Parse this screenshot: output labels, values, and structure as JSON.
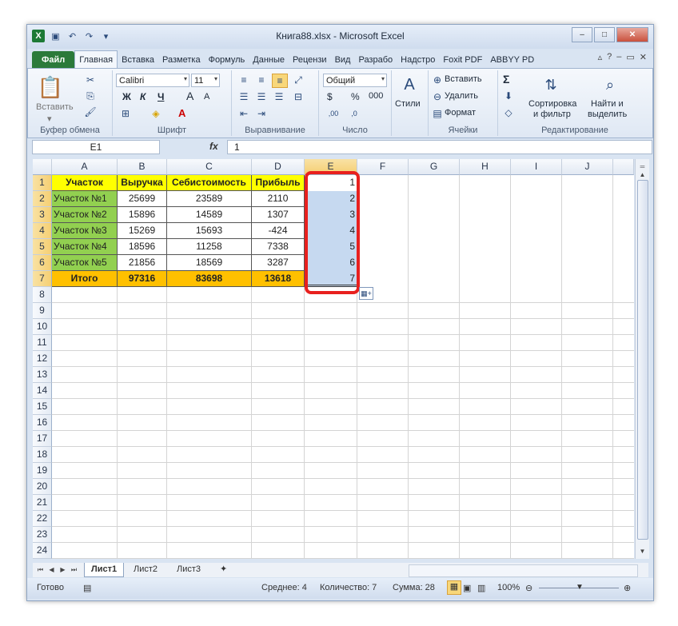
{
  "window": {
    "title": "Книга88.xlsx - Microsoft Excel",
    "min_label": "–",
    "max_label": "□",
    "close_label": "✕"
  },
  "qat": [
    "save-icon",
    "undo-icon",
    "redo-icon",
    "dropdown-icon"
  ],
  "ribbon_tabs": [
    "Файл",
    "Главная",
    "Вставка",
    "Разметка",
    "Формуль",
    "Данные",
    "Рецензи",
    "Вид",
    "Разрабо",
    "Надстро",
    "Foxit PDF",
    "ABBYY PD"
  ],
  "ribbon": {
    "clipboard": {
      "paste_label": "Вставить",
      "group_label": "Буфер обмена"
    },
    "font": {
      "font_name": "Calibri",
      "font_size": "11",
      "bold": "Ж",
      "italic": "К",
      "underline": "Ч",
      "grow": "A",
      "shrink": "A",
      "group_label": "Шрифт"
    },
    "alignment": {
      "group_label": "Выравнивание"
    },
    "number": {
      "format": "Общий",
      "currency": "$",
      "percent": "%",
      "thousands": "000",
      "group_label": "Число"
    },
    "styles": {
      "label": "Стили"
    },
    "cells": {
      "insert": "Вставить",
      "delete": "Удалить",
      "format": "Формат",
      "group_label": "Ячейки"
    },
    "editing": {
      "sum": "Σ",
      "sort_line1": "Сортировка",
      "sort_line2": "и фильтр",
      "find_line1": "Найти и",
      "find_line2": "выделить",
      "group_label": "Редактирование"
    }
  },
  "formula_bar": {
    "name_box": "E1",
    "fx": "fx",
    "value": "1"
  },
  "columns": [
    "A",
    "B",
    "C",
    "D",
    "E",
    "F",
    "G",
    "H",
    "I",
    "J"
  ],
  "rows": [
    "1",
    "2",
    "3",
    "4",
    "5",
    "6",
    "7",
    "8",
    "9",
    "10",
    "11",
    "12",
    "13",
    "14",
    "15",
    "16",
    "17",
    "18",
    "19",
    "20",
    "21",
    "22",
    "23",
    "24"
  ],
  "table": {
    "headers": [
      "Участок",
      "Выручка",
      "Себистоимость",
      "Прибыль"
    ],
    "data": [
      [
        "Участок №1",
        "25699",
        "23589",
        "2110"
      ],
      [
        "Участок №2",
        "15896",
        "14589",
        "1307"
      ],
      [
        "Участок №3",
        "15269",
        "15693",
        "-424"
      ],
      [
        "Участок №4",
        "18596",
        "11258",
        "7338"
      ],
      [
        "Участок №5",
        "21856",
        "18569",
        "3287"
      ]
    ],
    "total": [
      "Итого",
      "97316",
      "83698",
      "13618"
    ],
    "column_e": [
      "1",
      "2",
      "3",
      "4",
      "5",
      "6",
      "7"
    ]
  },
  "sheets": [
    "Лист1",
    "Лист2",
    "Лист3"
  ],
  "status": {
    "ready": "Готово",
    "average": "Среднее: 4",
    "count": "Количество: 7",
    "sum": "Сумма: 28",
    "zoom": "100%"
  },
  "colors": {
    "header_yellow": "#ffff00",
    "region_green": "#92d050",
    "total_orange": "#ffc000",
    "highlight_red": "#e8201e",
    "selection_blue": "#c6d9f0"
  }
}
